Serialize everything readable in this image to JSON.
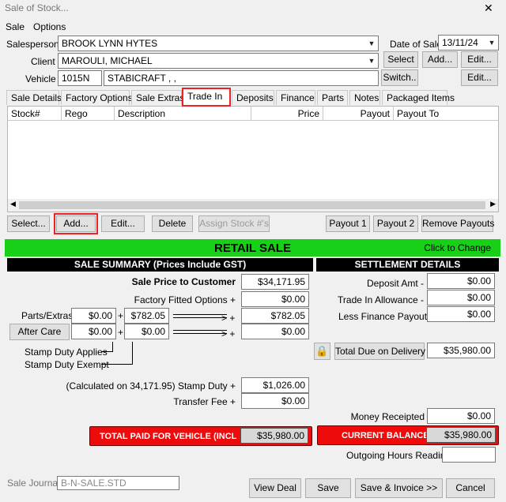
{
  "window": {
    "title": "Sale of Stock...",
    "close_label": "✕"
  },
  "menu": {
    "items": [
      "Sale",
      "Options"
    ]
  },
  "header": {
    "salesperson_label": "Salesperson",
    "salesperson_value": "BROOK LYNN HYTES",
    "client_label": "Client",
    "client_value": "MAROULI, MICHAEL",
    "vehicle_label": "Vehicle",
    "vehicle_stock": "1015N",
    "vehicle_desc": "STABICRAFT , ,",
    "date_label": "Date of Sale",
    "date_value": "13/11/24",
    "select_label": "Select",
    "add_label": "Add...",
    "edit_label": "Edit...",
    "switch_label": "Switch..",
    "vehicle_edit_label": "Edit..."
  },
  "tabs": [
    "Sale Details",
    "Factory Options",
    "Sale Extras",
    "Trade In",
    "Deposits",
    "Finance",
    "Parts",
    "Notes",
    "Packaged Items"
  ],
  "grid": {
    "columns": [
      "Stock#",
      "Rego",
      "Description",
      "Price",
      "Payout",
      "Payout To"
    ]
  },
  "grid_buttons": {
    "select": "Select...",
    "add": "Add...",
    "edit": "Edit...",
    "delete": "Delete",
    "assign": "Assign Stock #'s",
    "payout1": "Payout 1",
    "payout2": "Payout 2",
    "remove": "Remove Payouts"
  },
  "banner": {
    "title": "RETAIL SALE",
    "hint": "Click to Change"
  },
  "summary": {
    "heading": "SALE SUMMARY (Prices Include GST)",
    "sale_price_label": "Sale Price to Customer",
    "sale_price": "$34,171.95",
    "factory_label": "Factory Fitted Options +",
    "factory_value": "$0.00",
    "parts_label": "Parts/Extras",
    "parts_a": "$0.00",
    "parts_b": "$782.05",
    "parts_total": "$782.05",
    "aftercare_label": "After Care",
    "aftercare_a": "$0.00",
    "aftercare_b": "$0.00",
    "aftercare_total": "$0.00",
    "plus": "+",
    "arrow": "> +",
    "stamp_applies": "Stamp Duty Applies",
    "stamp_exempt": "Stamp Duty Exempt",
    "stamp_label": "(Calculated on 34,171.95) Stamp Duty +",
    "stamp_value": "$1,026.00",
    "transfer_label": "Transfer Fee +",
    "transfer_value": "$0.00",
    "total_label": "TOTAL PAID FOR VEHICLE (INCL",
    "total_value": "$35,980.00"
  },
  "settlement": {
    "heading": "SETTLEMENT DETAILS",
    "deposit_label": "Deposit Amt -",
    "deposit_value": "$0.00",
    "tradein_label": "Trade In Allowance -",
    "tradein_value": "$0.00",
    "finance_label": "Less Finance Payouts",
    "finance_value": "$0.00",
    "due_label": "Total Due on Delivery",
    "due_value": "$35,980.00",
    "money_label": "Money Receipted",
    "money_value": "$0.00",
    "balance_label": "CURRENT BALANCE",
    "balance_value": "$35,980.00",
    "hours_label": "Outgoing Hours Reading",
    "hours_value": ""
  },
  "footer": {
    "journal_label": "Sale Journal",
    "journal_value": "B-N-SALE.STD",
    "view_deal": "View Deal",
    "save": "Save",
    "save_invoice": "Save & Invoice >>",
    "cancel": "Cancel"
  },
  "colors": {
    "banner": "#18d018",
    "alert_red": "#ee0b0b",
    "highlight": "#e22222"
  }
}
